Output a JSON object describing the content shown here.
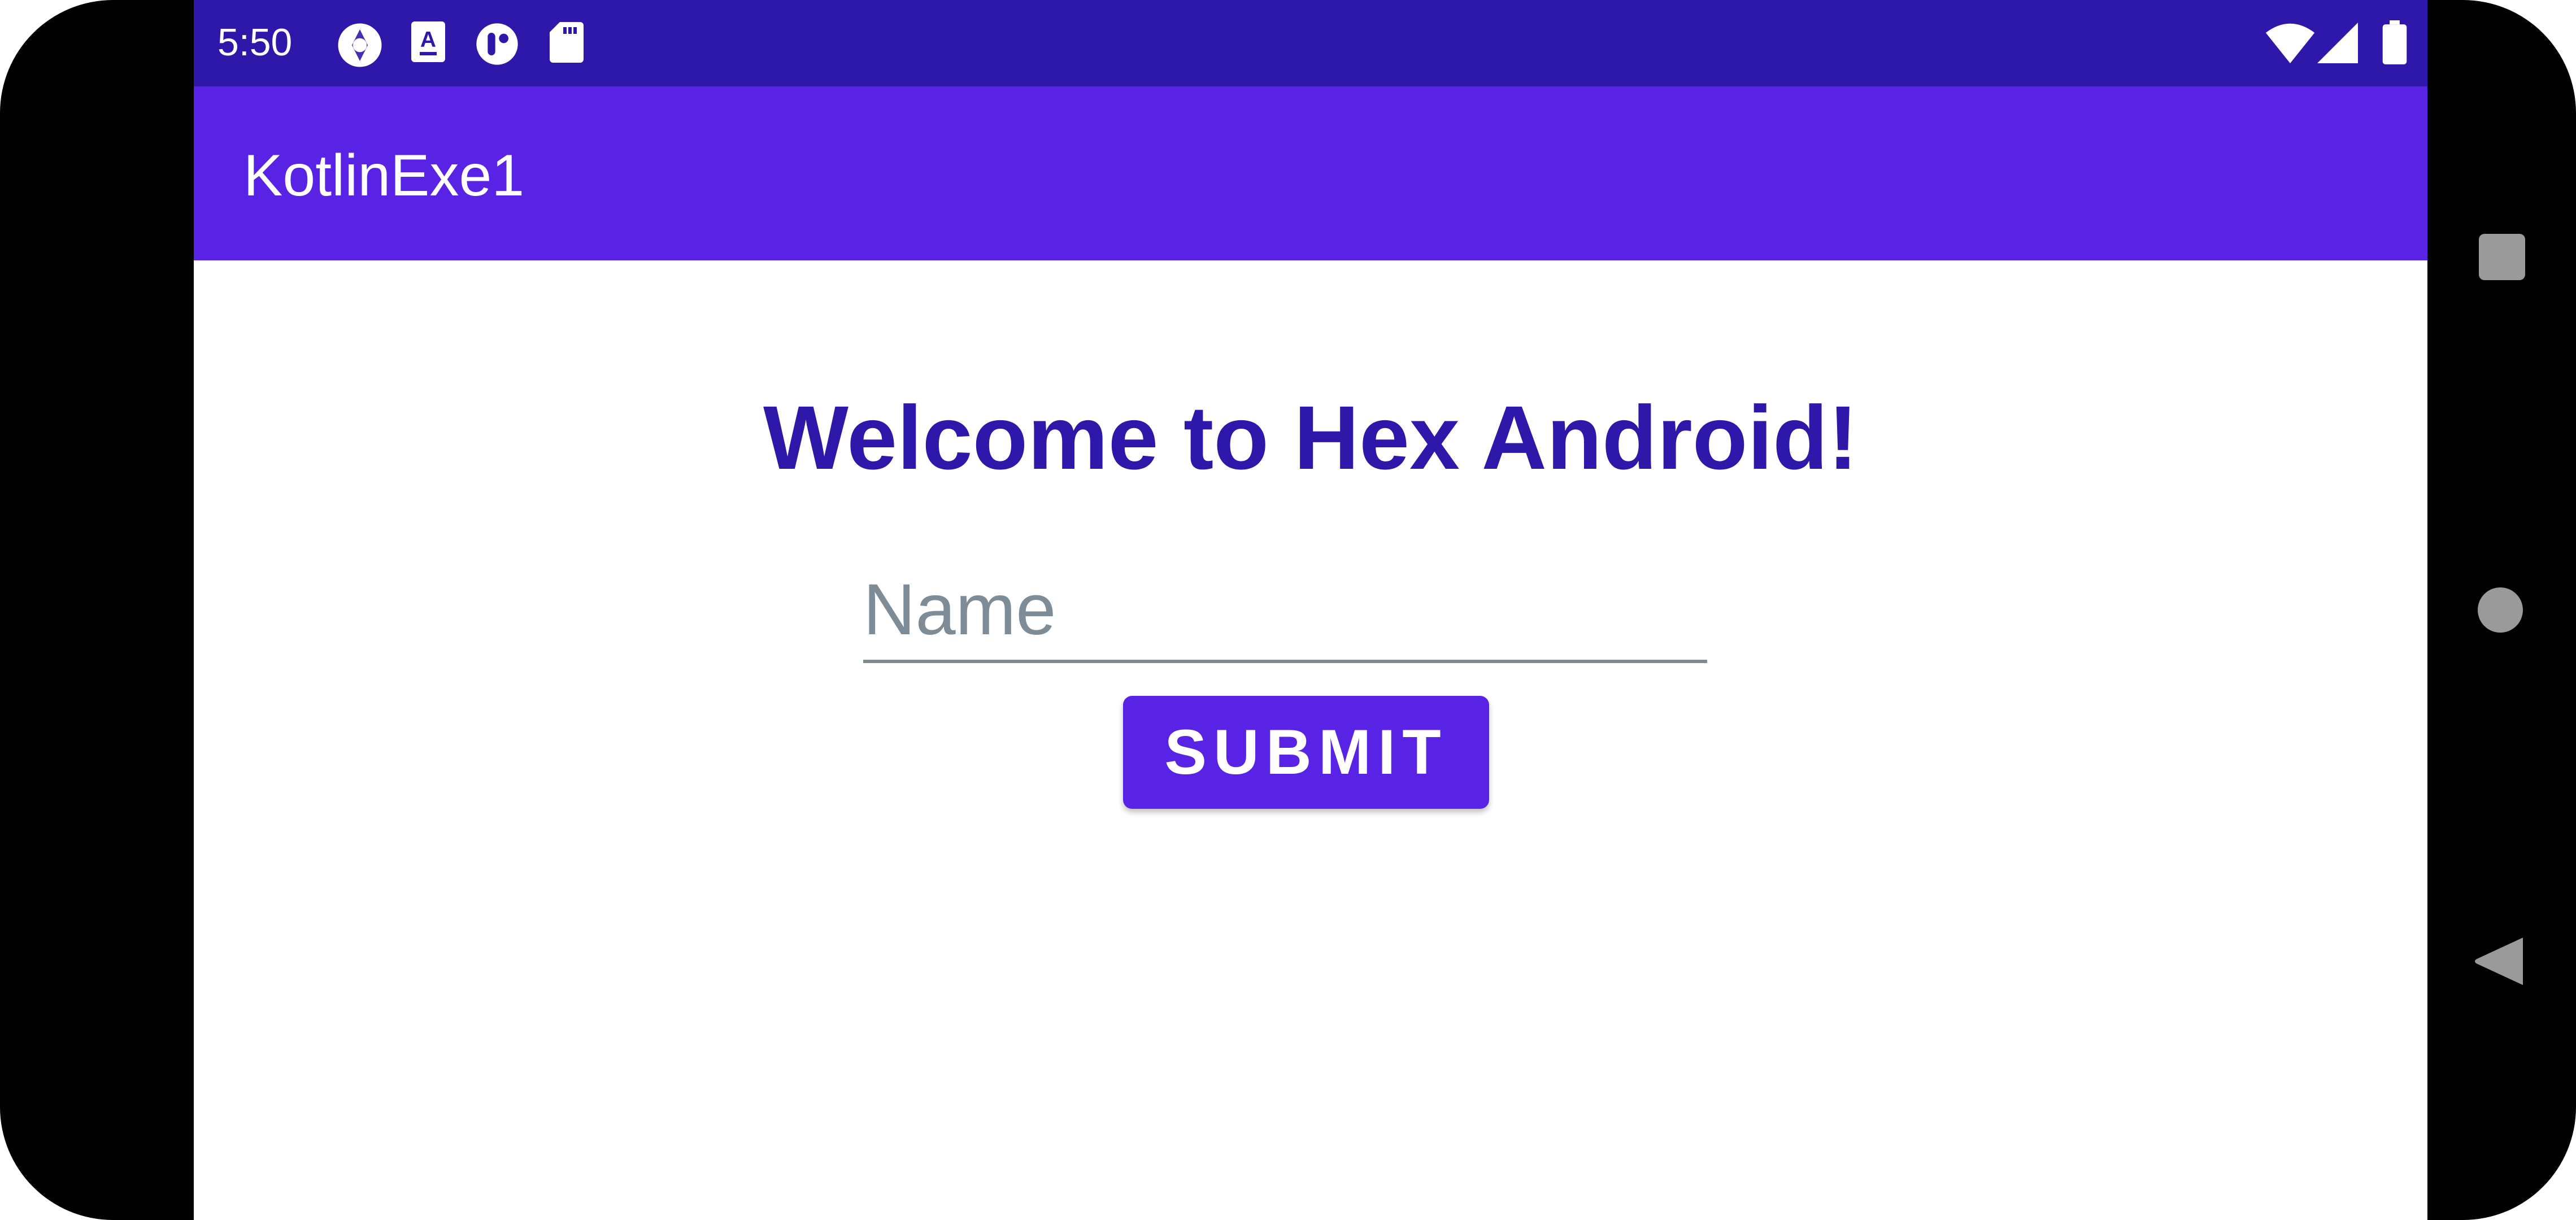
{
  "status_bar": {
    "time": "5:50",
    "background": "#2e18aa",
    "icons": [
      "aperture-icon",
      "text-a-icon",
      "app-badge-icon",
      "sd-card-icon",
      "wifi-icon",
      "cell-signal-icon",
      "battery-icon"
    ]
  },
  "app_bar": {
    "title": "KotlinExe1",
    "background": "#5823e5"
  },
  "main": {
    "welcome_text": "Welcome to Hex Android!",
    "welcome_color": "#2e18aa",
    "name_field": {
      "placeholder": "Name",
      "value": ""
    },
    "submit_label": "SUBMIT",
    "submit_color": "#5823e5"
  },
  "nav_bar": {
    "buttons": [
      "recents-button",
      "home-button",
      "back-button"
    ]
  }
}
